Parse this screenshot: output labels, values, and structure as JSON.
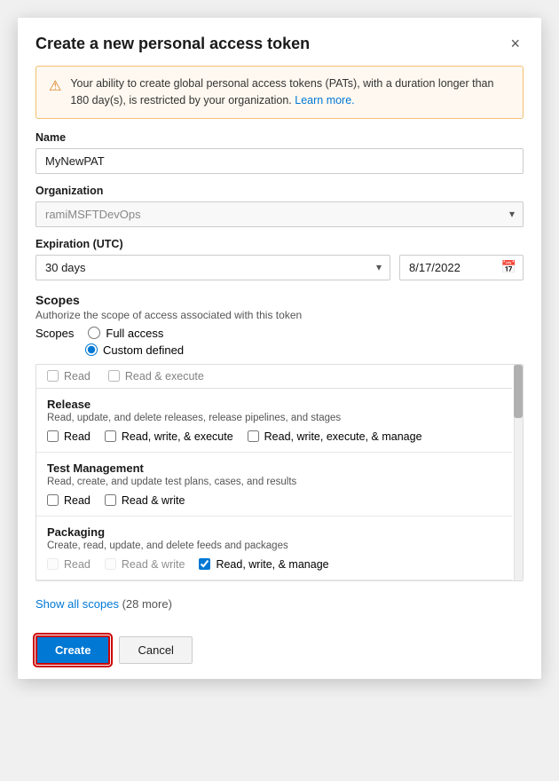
{
  "dialog": {
    "title": "Create a new personal access token",
    "close_label": "×"
  },
  "warning": {
    "icon": "⚠",
    "text": "Your ability to create global personal access tokens (PATs), with a duration longer than 180 day(s), is restricted by your organization.",
    "link_text": "Learn more.",
    "link_href": "#"
  },
  "fields": {
    "name_label": "Name",
    "name_value": "MyNewPAT",
    "name_placeholder": "",
    "org_label": "Organization",
    "org_value": "ramiMSFTDevOps",
    "expiration_label": "Expiration (UTC)",
    "expiration_option": "30 days",
    "expiration_date": "8/17/2022"
  },
  "scopes": {
    "title": "Scopes",
    "description": "Authorize the scope of access associated with this token",
    "scopes_label": "Scopes",
    "full_access_label": "Full access",
    "custom_defined_label": "Custom defined",
    "fade_row": {
      "read_label": "Read",
      "read_execute_label": "Read & execute"
    },
    "groups": [
      {
        "id": "release",
        "title": "Release",
        "description": "Read, update, and delete releases, release pipelines, and stages",
        "options": [
          {
            "label": "Read",
            "checked": false,
            "disabled": false
          },
          {
            "label": "Read, write, & execute",
            "checked": false,
            "disabled": false
          },
          {
            "label": "Read, write, execute, & manage",
            "checked": false,
            "disabled": false
          }
        ]
      },
      {
        "id": "test-management",
        "title": "Test Management",
        "description": "Read, create, and update test plans, cases, and results",
        "options": [
          {
            "label": "Read",
            "checked": false,
            "disabled": false
          },
          {
            "label": "Read & write",
            "checked": false,
            "disabled": false
          }
        ]
      },
      {
        "id": "packaging",
        "title": "Packaging",
        "description": "Create, read, update, and delete feeds and packages",
        "options": [
          {
            "label": "Read",
            "checked": false,
            "disabled": true
          },
          {
            "label": "Read & write",
            "checked": false,
            "disabled": true
          },
          {
            "label": "Read, write, & manage",
            "checked": true,
            "disabled": false
          }
        ]
      }
    ],
    "show_all_text": "Show all scopes",
    "show_all_count": "(28 more)"
  },
  "footer": {
    "create_label": "Create",
    "cancel_label": "Cancel"
  }
}
